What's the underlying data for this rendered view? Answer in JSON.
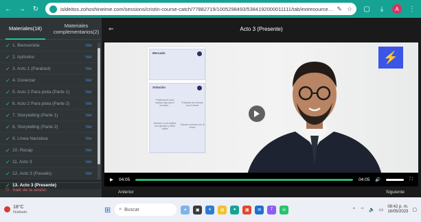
{
  "browser": {
    "url": "isldeitos.zohoshineime.com/sessions/cristin-course-catch/77882719/1005298493/5384192000011111/tab/extresource/518831000005155253/vct...",
    "accent": "#16a394",
    "profile_initial": "A"
  },
  "sidebar": {
    "tabs": [
      {
        "label": "Materiales(18)",
        "active": true
      },
      {
        "label": "Materiales complementarios(2)",
        "active": false
      }
    ],
    "lessons": [
      {
        "label": "1. Bienvenida",
        "view": "Ver",
        "done": true
      },
      {
        "label": "2. Aplíndos",
        "view": "Ver",
        "done": true
      },
      {
        "label": "3. Acto 1 (Paralout)",
        "view": "Ver",
        "done": true
      },
      {
        "label": "4. Conectar",
        "view": "Ver",
        "done": true
      },
      {
        "label": "5. Acto 2 Para piola (Parte 1)",
        "view": "Ver",
        "done": true
      },
      {
        "label": "6. Acto 2 Para piola (Parte 2)",
        "view": "Ver",
        "done": true
      },
      {
        "label": "7. Storytelling (Parte 1)",
        "view": "Ver",
        "done": true
      },
      {
        "label": "8. Storytelling (Parte 2)",
        "view": "Ver",
        "done": true
      },
      {
        "label": "9. Línea Narrativa",
        "view": "Ver",
        "done": true
      },
      {
        "label": "10. Recap",
        "view": "Ver",
        "done": true
      },
      {
        "label": "11. Acto 3",
        "view": "Ver",
        "done": true
      },
      {
        "label": "12. Acto 3 (Pasado)",
        "view": "Ver",
        "done": true
      },
      {
        "label": "13. Acto 3 (Presente)",
        "view": "",
        "done": true,
        "current": true
      }
    ],
    "exit_label": "Salir de la sesión"
  },
  "main": {
    "title": "Acto 3 (Presente)",
    "back_icon": "back-arrow-icon",
    "slide": {
      "top_label": "Mercado",
      "bottom_label": "Solución",
      "cells": [
        "Problema\nde cómo\nexplicar\nalgo que el\nmercado...",
        "Problema\nde conectar\ncon el cliente",
        "Solución\nLa de explicar\ncon ejemplos\ny datos reales",
        "Solución\nconectar\ncon la marca"
      ]
    },
    "logo_glyph": "⚡",
    "logo_color": "#3a55e8",
    "time_current": "04:05",
    "time_total": "04:05",
    "progress": 1.0,
    "prev_label": "Anterior",
    "next_label": "Siguiente"
  },
  "taskbar": {
    "weather": "18°C",
    "weather_sub": "Nublado",
    "search_placeholder": "Buscar",
    "time": "08:42 p. m.",
    "date": "16/05/2023"
  }
}
